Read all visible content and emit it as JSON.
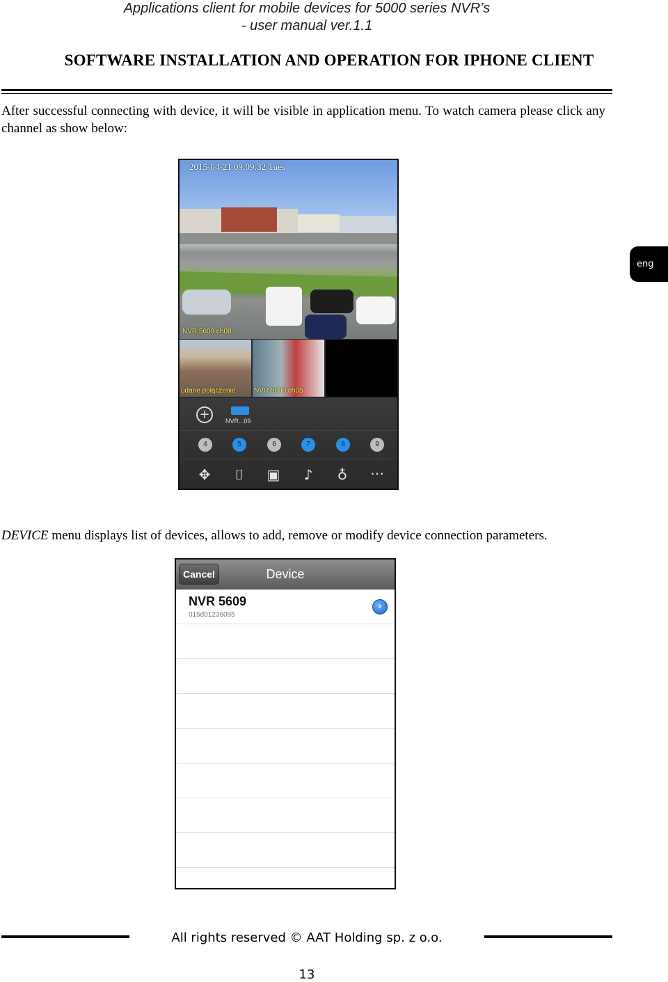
{
  "header": {
    "line1": "Applications client for mobile devices for 5000 series NVR’s",
    "line2": "- user manual ver.1.1"
  },
  "section_heading": "SOFTWARE INSTALLATION AND OPERATION FOR IPHONE CLIENT",
  "paragraph1": "After successful connecting with device, it will be visible in application menu. To watch camera please click any channel as show below:",
  "paragraph2": {
    "italic_word": "DEVICE",
    "rest": " menu displays list of devices, allows to add, remove or modify device connection parameters."
  },
  "live_view_screenshot": {
    "timestamp": "2015-04-21 09:09:32 Tues",
    "main_camera_label": "NVR 5609 ch08",
    "sub_camera1_label": "udane połączenie",
    "sub_camera2_label": "NVR 5609 ch05",
    "device_chip_label": "NVR...09",
    "channels": [
      {
        "label": "4",
        "active": false
      },
      {
        "label": "5",
        "active": true
      },
      {
        "label": "6",
        "active": false
      },
      {
        "label": "7",
        "active": true
      },
      {
        "label": "8",
        "active": true
      },
      {
        "label": "9",
        "active": false
      }
    ],
    "icons": [
      "add-icon",
      "move-ptz-icon",
      "camera-icon",
      "record-icon",
      "speaker-icon",
      "microphone-icon",
      "more-icon"
    ]
  },
  "device_screenshot": {
    "cancel_label": "Cancel",
    "title": "Device",
    "device_name": "NVR 5609",
    "device_serial": "015d01236095"
  },
  "side_tab": "eng",
  "footer": {
    "rights": "All rights reserved © AAT Holding sp. z o.o.",
    "page_number": "13"
  }
}
